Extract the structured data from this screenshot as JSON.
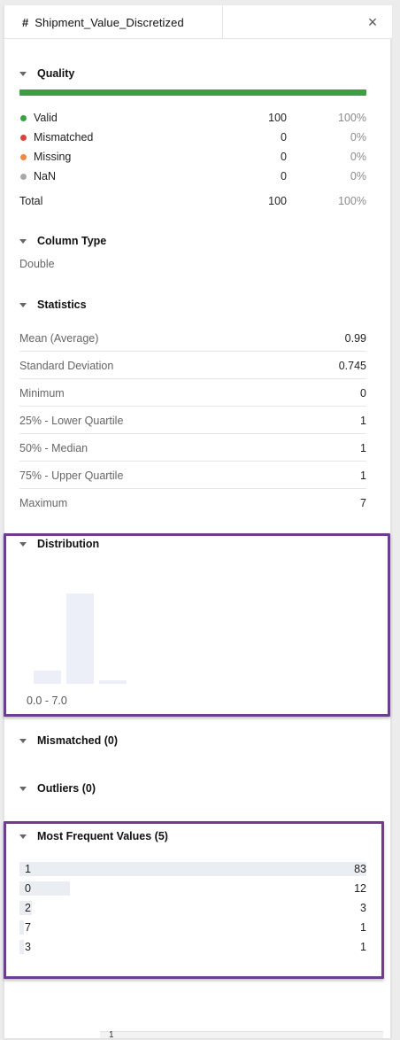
{
  "tab": {
    "hash": "#",
    "title": "Shipment_Value_Discretized",
    "close": "×"
  },
  "quality": {
    "heading": "Quality",
    "bar_color": "#3aa043",
    "rows": [
      {
        "label": "Valid",
        "count": "100",
        "pct": "100%",
        "color": "#3aa043"
      },
      {
        "label": "Mismatched",
        "count": "0",
        "pct": "0%",
        "color": "#d64541"
      },
      {
        "label": "Missing",
        "count": "0",
        "pct": "0%",
        "color": "#f0883e"
      },
      {
        "label": "NaN",
        "count": "0",
        "pct": "0%",
        "color": "#a8a8a8"
      }
    ],
    "total": {
      "label": "Total",
      "count": "100",
      "pct": "100%"
    }
  },
  "column_type": {
    "heading": "Column Type",
    "value": "Double"
  },
  "statistics": {
    "heading": "Statistics",
    "rows": [
      {
        "label": "Mean (Average)",
        "value": "0.99"
      },
      {
        "label": "Standard Deviation",
        "value": "0.745"
      },
      {
        "label": "Minimum",
        "value": "0"
      },
      {
        "label": "25% - Lower Quartile",
        "value": "1"
      },
      {
        "label": "50% - Median",
        "value": "1"
      },
      {
        "label": "75% - Upper Quartile",
        "value": "1"
      },
      {
        "label": "Maximum",
        "value": "7"
      }
    ]
  },
  "distribution": {
    "heading": "Distribution",
    "range_label": "0.0 - 7.0",
    "bars": [
      12,
      83,
      3
    ]
  },
  "mismatched": {
    "heading": "Mismatched (0)"
  },
  "outliers": {
    "heading": "Outliers (0)"
  },
  "most_frequent": {
    "heading": "Most Frequent Values (5)",
    "items": [
      {
        "value": "1",
        "count": "83",
        "n": 83
      },
      {
        "value": "0",
        "count": "12",
        "n": 12
      },
      {
        "value": "2",
        "count": "3",
        "n": 3
      },
      {
        "value": "7",
        "count": "1",
        "n": 1
      },
      {
        "value": "3",
        "count": "1",
        "n": 1
      }
    ]
  },
  "footer": {
    "tick": "1"
  }
}
